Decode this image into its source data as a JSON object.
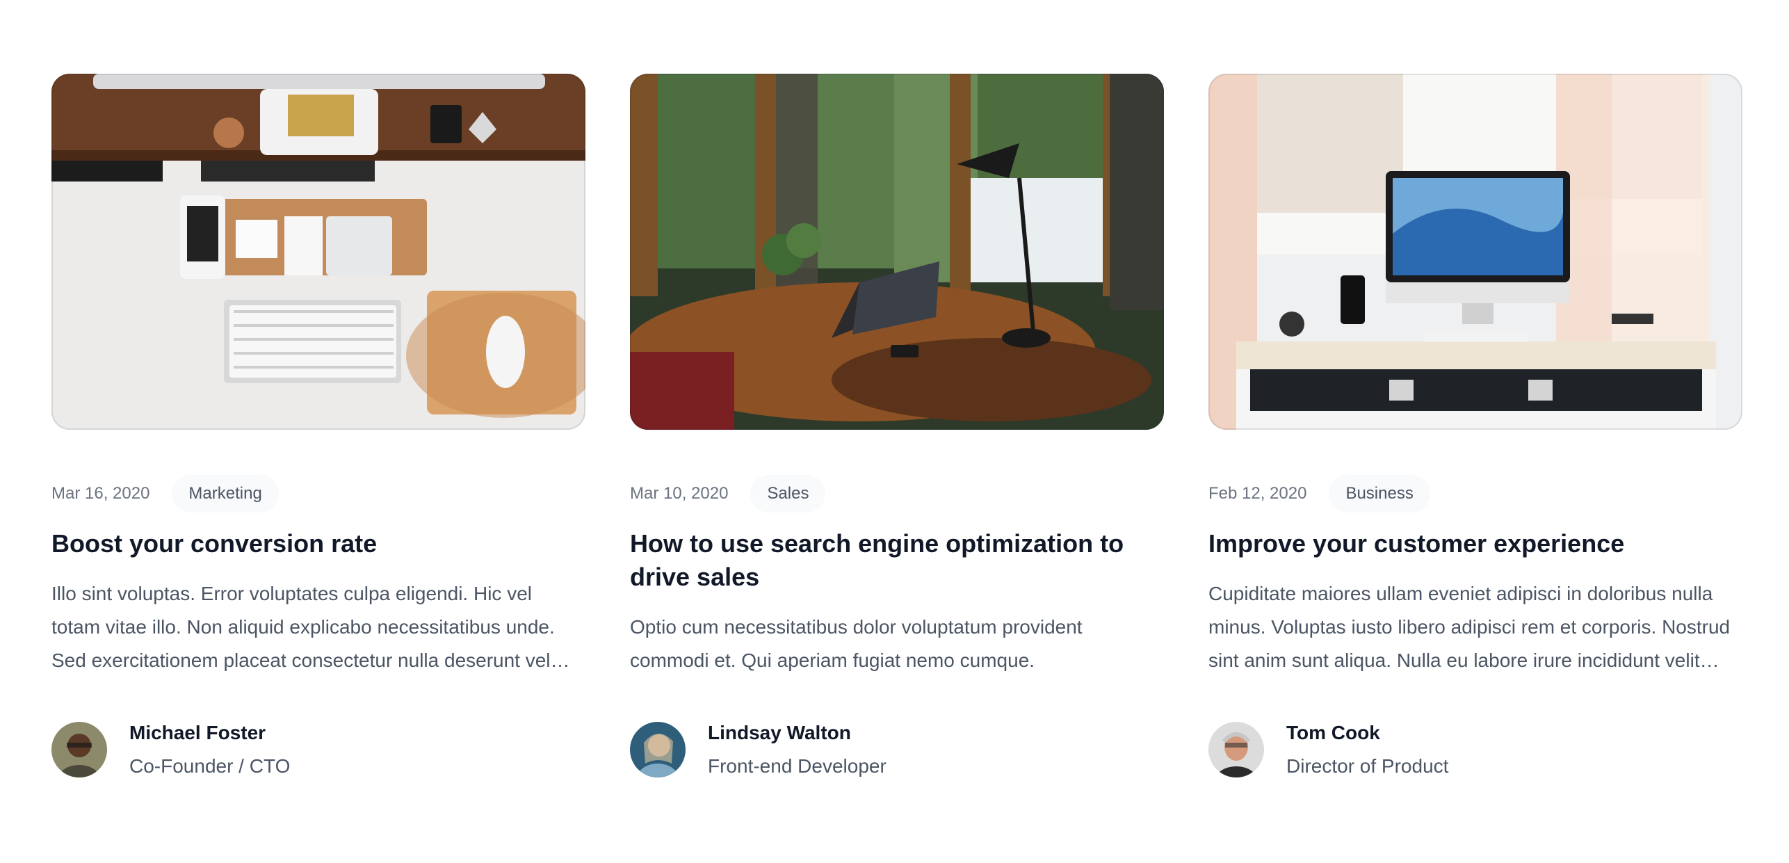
{
  "posts": [
    {
      "date": "Mar 16, 2020",
      "category": "Marketing",
      "title": "Boost your conversion rate",
      "excerpt": "Illo sint voluptas. Error voluptates culpa eligendi. Hic vel totam vitae illo. Non aliquid explicabo necessitatibus unde. Sed exercitationem placeat consectetur nulla deserunt vel iusto corrupti dicta laboris incididunt.",
      "author": {
        "name": "Michael Foster",
        "role": "Co-Founder / CTO"
      }
    },
    {
      "date": "Mar 10, 2020",
      "category": "Sales",
      "title": "How to use search engine optimization to drive sales",
      "excerpt": "Optio cum necessitatibus dolor voluptatum provident commodi et. Qui aperiam fugiat nemo cumque.",
      "author": {
        "name": "Lindsay Walton",
        "role": "Front-end Developer"
      }
    },
    {
      "date": "Feb 12, 2020",
      "category": "Business",
      "title": "Improve your customer experience",
      "excerpt": "Cupiditate maiores ullam eveniet adipisci in doloribus nulla minus. Voluptas iusto libero adipisci rem et corporis. Nostrud sint anim sunt aliqua. Nulla eu labore irure incididunt velit cillum quis magna dolore.",
      "author": {
        "name": "Tom Cook",
        "role": "Director of Product"
      }
    }
  ]
}
